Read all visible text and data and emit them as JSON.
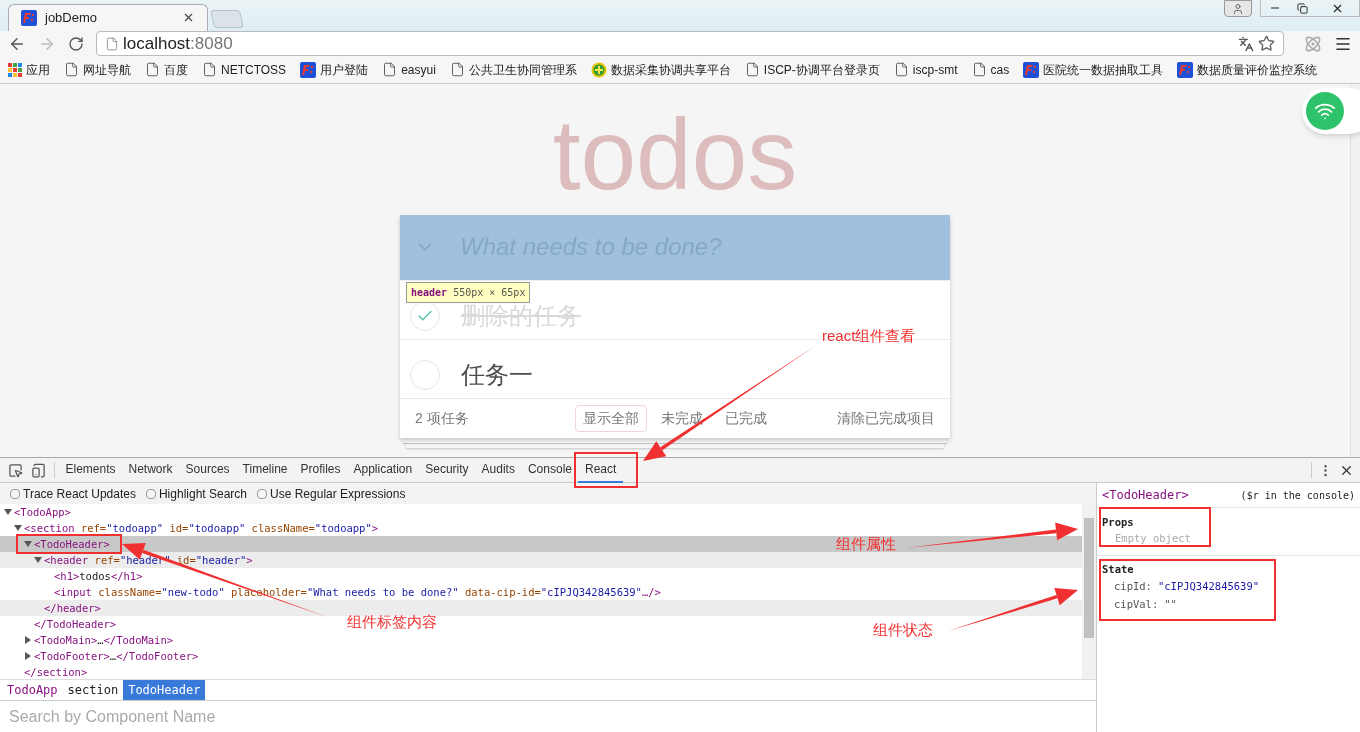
{
  "browser": {
    "tab": {
      "title": "jobDemo"
    },
    "url": {
      "host": "localhost",
      "port": ":8080"
    },
    "bookmarks": [
      {
        "label": "应用",
        "kind": "apps"
      },
      {
        "label": "网址导航",
        "kind": "page"
      },
      {
        "label": "百度",
        "kind": "page"
      },
      {
        "label": "NETCTOSS",
        "kind": "page"
      },
      {
        "label": "用户登陆",
        "kind": "app"
      },
      {
        "label": "easyui",
        "kind": "page"
      },
      {
        "label": "公共卫生协同管理系",
        "kind": "page"
      },
      {
        "label": "数据采集协调共享平台",
        "kind": "plus"
      },
      {
        "label": "ISCP-协调平台登录页",
        "kind": "page"
      },
      {
        "label": "iscp-smt",
        "kind": "page"
      },
      {
        "label": "cas",
        "kind": "page"
      },
      {
        "label": "医院统一数据抽取工具",
        "kind": "app"
      },
      {
        "label": "数据质量评价监控系统",
        "kind": "app"
      }
    ]
  },
  "page": {
    "title": "todos",
    "new_todo": {
      "placeholder": "What needs to be done?"
    },
    "todos": [
      {
        "text": "删除的任务",
        "completed": true
      },
      {
        "text": "任务一",
        "completed": false
      }
    ],
    "footer": {
      "count": "2 项任务",
      "filters": [
        {
          "label": "显示全部",
          "selected": true
        },
        {
          "label": "未完成",
          "selected": false
        },
        {
          "label": "已完成",
          "selected": false
        }
      ],
      "clear": "清除已完成项目"
    },
    "tooltip": {
      "tag": "header",
      "size": "550px × 65px"
    }
  },
  "devtools": {
    "tabs": [
      {
        "label": "Elements",
        "selected": false
      },
      {
        "label": "Network",
        "selected": false
      },
      {
        "label": "Sources",
        "selected": false
      },
      {
        "label": "Timeline",
        "selected": false
      },
      {
        "label": "Profiles",
        "selected": false
      },
      {
        "label": "Application",
        "selected": false
      },
      {
        "label": "Security",
        "selected": false
      },
      {
        "label": "Audits",
        "selected": false
      },
      {
        "label": "Console",
        "selected": false
      },
      {
        "label": "React",
        "selected": true
      }
    ],
    "options": [
      {
        "label": "Trace React Updates",
        "checked": false
      },
      {
        "label": "Highlight Search",
        "checked": false
      },
      {
        "label": "Use Regular Expressions",
        "checked": false
      }
    ],
    "tree": [
      {
        "open": [
          {
            "text": "<TodoApp>",
            "kind": "tag"
          }
        ],
        "expanded": true,
        "selected": false,
        "hovered": false,
        "children": [
          {
            "open": [
              {
                "text": "<section",
                "kind": "tag"
              },
              {
                "text": " ref=",
                "kind": "attr"
              },
              {
                "text": "\"todoapp\"",
                "kind": "value"
              },
              {
                "text": " id=",
                "kind": "attr"
              },
              {
                "text": "\"todoapp\"",
                "kind": "value"
              },
              {
                "text": " className=",
                "kind": "attr"
              },
              {
                "text": "\"todoapp\"",
                "kind": "value"
              },
              {
                "text": ">",
                "kind": "tag"
              }
            ],
            "close": [
              {
                "text": "</section>",
                "kind": "tag"
              }
            ],
            "expanded": true,
            "selected": false,
            "hovered": false,
            "children": [
              {
                "open": [
                  {
                    "text": "<TodoHeader>",
                    "kind": "tag"
                  }
                ],
                "close": [
                  {
                    "text": "</TodoHeader>",
                    "kind": "tag"
                  }
                ],
                "expanded": true,
                "selected": true,
                "hovered": false,
                "children": [
                  {
                    "open": [
                      {
                        "text": "<header",
                        "kind": "tag"
                      },
                      {
                        "text": " ref=",
                        "kind": "attr"
                      },
                      {
                        "text": "\"header\"",
                        "kind": "value"
                      },
                      {
                        "text": " id=",
                        "kind": "attr"
                      },
                      {
                        "text": "\"header\"",
                        "kind": "value"
                      },
                      {
                        "text": ">",
                        "kind": "tag"
                      }
                    ],
                    "close": [
                      {
                        "text": "</header>",
                        "kind": "tag"
                      }
                    ],
                    "expanded": true,
                    "selected": false,
                    "hovered": true,
                    "children": [
                      {
                        "open": [
                          {
                            "text": "<h1>",
                            "kind": "tag"
                          },
                          {
                            "text": "todos",
                            "kind": "text"
                          },
                          {
                            "text": "</h1>",
                            "kind": "tag"
                          }
                        ],
                        "selected": false,
                        "hovered": false
                      },
                      {
                        "open": [
                          {
                            "text": "<input",
                            "kind": "tag"
                          },
                          {
                            "text": " className=",
                            "kind": "attr"
                          },
                          {
                            "text": "\"new-todo\"",
                            "kind": "value"
                          },
                          {
                            "text": " placeholder=",
                            "kind": "attr"
                          },
                          {
                            "text": "\"What needs to be done?\"",
                            "kind": "value"
                          },
                          {
                            "text": " data-cip-id=",
                            "kind": "attr"
                          },
                          {
                            "text": "\"cIPJQ342845639\"",
                            "kind": "value"
                          },
                          {
                            "text": "…/>",
                            "kind": "tag"
                          }
                        ],
                        "selected": false,
                        "hovered": false
                      }
                    ]
                  }
                ]
              },
              {
                "open": [
                  {
                    "text": "<TodoMain>",
                    "kind": "tag"
                  },
                  {
                    "text": "…",
                    "kind": "text"
                  },
                  {
                    "text": "</TodoMain>",
                    "kind": "tag"
                  }
                ],
                "expanded": false,
                "selected": false,
                "hovered": false
              },
              {
                "open": [
                  {
                    "text": "<TodoFooter>",
                    "kind": "tag"
                  },
                  {
                    "text": "…",
                    "kind": "text"
                  },
                  {
                    "text": "</TodoFooter>",
                    "kind": "tag"
                  }
                ],
                "expanded": false,
                "selected": false,
                "hovered": false
              }
            ]
          }
        ]
      }
    ],
    "breadcrumb": [
      {
        "label": "TodoApp",
        "kind": "component",
        "selected": false
      },
      {
        "label": "section",
        "kind": "dom",
        "selected": false
      },
      {
        "label": "TodoHeader",
        "kind": "component",
        "selected": true
      }
    ],
    "search": {
      "placeholder": "Search by Component Name"
    },
    "side": {
      "component": "<TodoHeader>",
      "hint": "($r in the console)",
      "props": {
        "title": "Props",
        "empty": "Empty object"
      },
      "state": {
        "title": "State",
        "entries": [
          {
            "key": "cipId:",
            "value": "\"cIPJQ342845639\"",
            "kind": "string"
          },
          {
            "key": "cipVal:",
            "value": "\"\"",
            "kind": "empty"
          }
        ]
      }
    }
  },
  "annotations": [
    "react组件查看",
    "组件属性",
    "组件标签内容",
    "组件状态"
  ]
}
